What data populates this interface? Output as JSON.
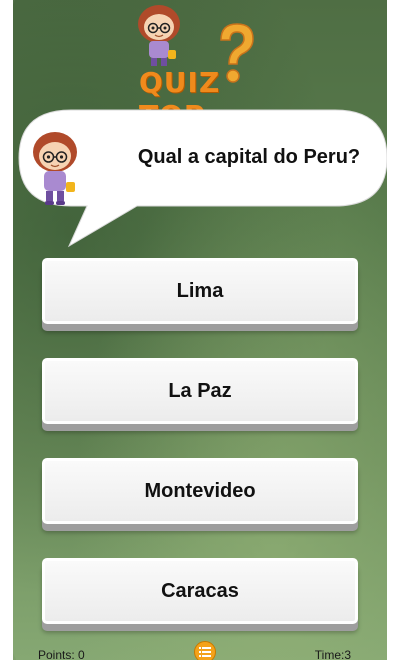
{
  "logo": {
    "text": "QUIZ TOP"
  },
  "question": {
    "text": "Qual a capital do Peru?"
  },
  "answers": [
    {
      "label": "Lima"
    },
    {
      "label": "La Paz"
    },
    {
      "label": "Montevideo"
    },
    {
      "label": "Caracas"
    }
  ],
  "footer": {
    "points": "Points: 0",
    "time": "Time:3"
  },
  "icons": {
    "logo_mascot": "girl-mascot-icon",
    "question_mark": "question-mark-icon",
    "bubble_mascot": "girl-mascot-icon",
    "menu": "list-menu-icon"
  },
  "colors": {
    "accent": "#f08a1c",
    "board": "#5a7d4d"
  }
}
